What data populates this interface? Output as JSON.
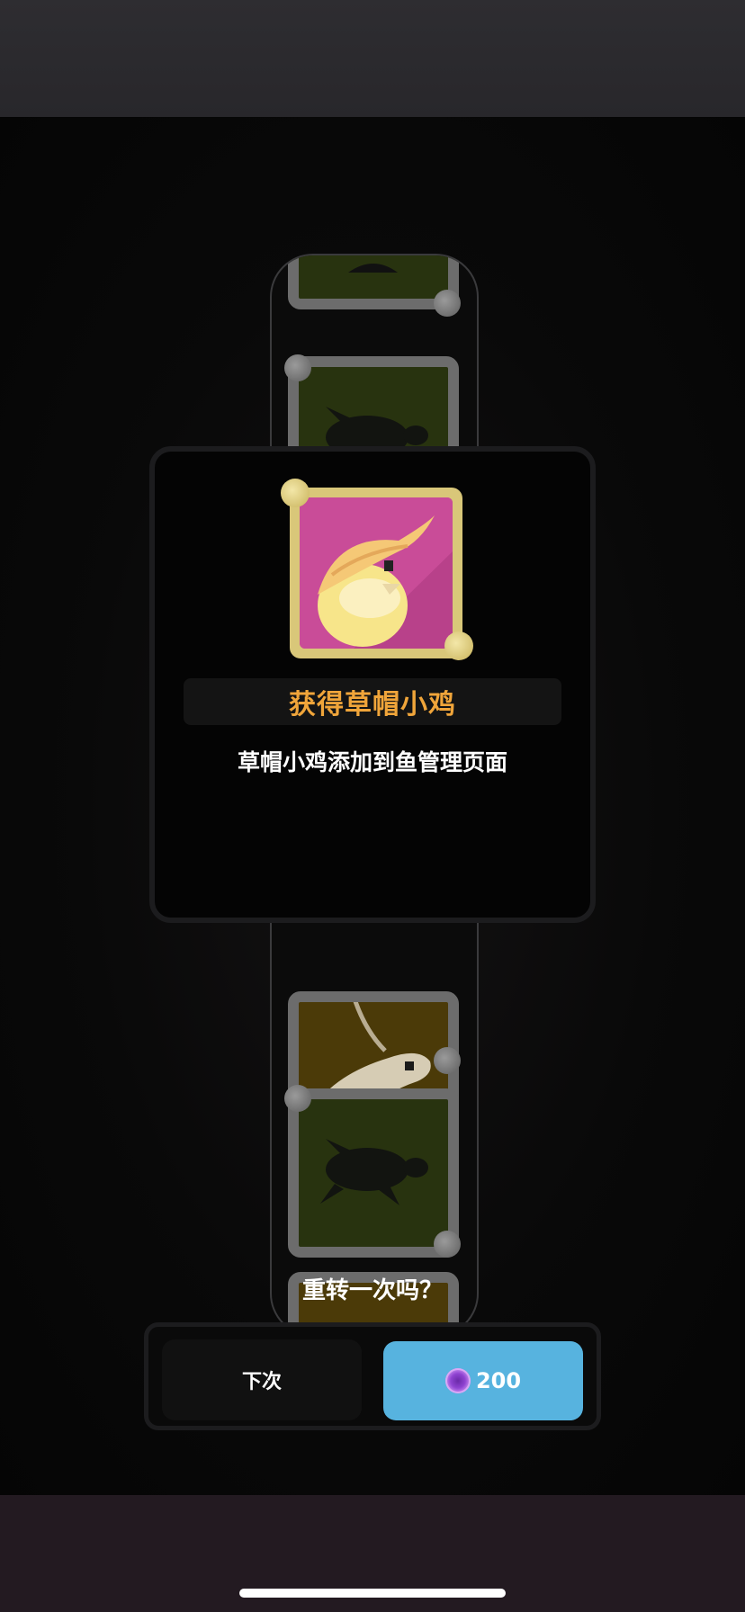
{
  "reward": {
    "title": "获得草帽小鸡",
    "description": "草帽小鸡添加到鱼管理页面",
    "image_icon": "straw-hat-chick-icon"
  },
  "reel": {
    "icons": [
      "turtle-icon",
      "goose-icon",
      "turtle-icon"
    ]
  },
  "respin_prompt": "重转一次吗？",
  "buttons": {
    "next_label": "下次",
    "spin_cost": "200",
    "spin_icon": "gem-icon"
  },
  "colors": {
    "accent_orange": "#f0a53a",
    "spin_button": "#57b3df",
    "reward_background": "#c94c98",
    "reward_frame": "#d9c779"
  }
}
